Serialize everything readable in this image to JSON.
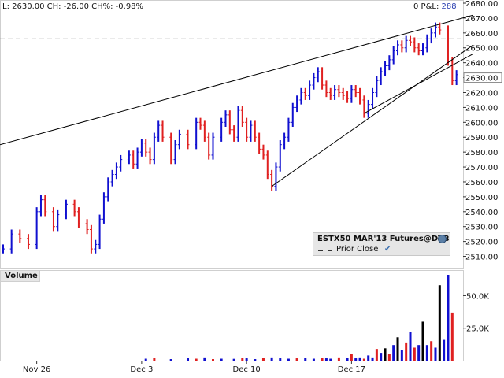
{
  "status_bar": {
    "quote": "L: 2630.00 CH: -26.00 CH%: -0.98%",
    "pnl_label": "0 P&L:",
    "pnl_value": "288"
  },
  "legend": {
    "title": "ESTX50 MAR'13 Futures@DTB",
    "prior_close_label": "Prior Close",
    "gear_icon": "gear-icon",
    "check_icon": "check-icon"
  },
  "volume_panel": {
    "label": "Volume"
  },
  "colors": {
    "up": "#1010d0",
    "down": "#e02020",
    "neutral": "#000000",
    "panel_bg": "#e6e6e6"
  },
  "chart_data": [
    {
      "type": "candlestick",
      "title": "ESTX50 MAR'13 Futures@DTB",
      "x_tick_labels": [
        "Nov 26",
        "Dec 3",
        "Dec 10",
        "Dec 17"
      ],
      "y_tick_labels": [
        2680,
        2670,
        2660,
        2650,
        2640,
        2630,
        2620,
        2610,
        2600,
        2590,
        2580,
        2570,
        2560,
        2550,
        2540,
        2530,
        2520,
        2510
      ],
      "ylim": [
        2505,
        2684
      ],
      "prior_close": 2656,
      "last": 2630,
      "series": [
        {
          "name": "Price",
          "points": [
            [
              0,
              2515
            ],
            [
              2,
              2525
            ],
            [
              4,
              2522
            ],
            [
              6,
              2518
            ],
            [
              8,
              2540
            ],
            [
              9,
              2548
            ],
            [
              10,
              2540
            ],
            [
              12,
              2530
            ],
            [
              13,
              2538
            ],
            [
              15,
              2545
            ],
            [
              17,
              2540
            ],
            [
              18,
              2532
            ],
            [
              20,
              2528
            ],
            [
              21,
              2515
            ],
            [
              22,
              2518
            ],
            [
              23,
              2535
            ],
            [
              24,
              2550
            ],
            [
              25,
              2560
            ],
            [
              26,
              2565
            ],
            [
              27,
              2570
            ],
            [
              28,
              2575
            ],
            [
              30,
              2578
            ],
            [
              31,
              2572
            ],
            [
              32,
              2580
            ],
            [
              33,
              2586
            ],
            [
              34,
              2580
            ],
            [
              35,
              2575
            ],
            [
              36,
              2590
            ],
            [
              37,
              2598
            ],
            [
              38,
              2590
            ],
            [
              40,
              2575
            ],
            [
              41,
              2585
            ],
            [
              42,
              2592
            ],
            [
              44,
              2585
            ],
            [
              46,
              2600
            ],
            [
              47,
              2598
            ],
            [
              48,
              2590
            ],
            [
              49,
              2578
            ],
            [
              50,
              2590
            ],
            [
              52,
              2600
            ],
            [
              53,
              2605
            ],
            [
              54,
              2595
            ],
            [
              55,
              2590
            ],
            [
              56,
              2608
            ],
            [
              57,
              2600
            ],
            [
              58,
              2590
            ],
            [
              59,
              2598
            ],
            [
              60,
              2590
            ],
            [
              61,
              2582
            ],
            [
              62,
              2578
            ],
            [
              63,
              2565
            ],
            [
              64,
              2557
            ],
            [
              65,
              2570
            ],
            [
              66,
              2585
            ],
            [
              67,
              2590
            ],
            [
              68,
              2600
            ],
            [
              69,
              2610
            ],
            [
              70,
              2615
            ],
            [
              71,
              2620
            ],
            [
              72,
              2618
            ],
            [
              73,
              2625
            ],
            [
              74,
              2630
            ],
            [
              75,
              2634
            ],
            [
              76,
              2625
            ],
            [
              77,
              2620
            ],
            [
              78,
              2618
            ],
            [
              79,
              2622
            ],
            [
              80,
              2620
            ],
            [
              81,
              2618
            ],
            [
              82,
              2616
            ],
            [
              83,
              2622
            ],
            [
              84,
              2620
            ],
            [
              85,
              2615
            ],
            [
              86,
              2606
            ],
            [
              87,
              2612
            ],
            [
              88,
              2620
            ],
            [
              89,
              2628
            ],
            [
              90,
              2634
            ],
            [
              91,
              2638
            ],
            [
              92,
              2642
            ],
            [
              93,
              2648
            ],
            [
              94,
              2652
            ],
            [
              95,
              2650
            ],
            [
              96,
              2655
            ],
            [
              97,
              2654
            ],
            [
              98,
              2650
            ],
            [
              99,
              2648
            ],
            [
              100,
              2650
            ],
            [
              101,
              2656
            ],
            [
              102,
              2660
            ],
            [
              103,
              2664
            ],
            [
              104,
              2662
            ],
            [
              106,
              2641
            ],
            [
              107,
              2628
            ],
            [
              108,
              2632
            ]
          ]
        }
      ],
      "trendlines": [
        {
          "from": [
            -2,
            2584
          ],
          "to": [
            112,
            2672
          ]
        },
        {
          "from": [
            64,
            2557
          ],
          "to": [
            112,
            2652
          ]
        },
        {
          "from": [
            86,
            2606
          ],
          "to": [
            112,
            2646
          ]
        }
      ],
      "volume": {
        "ylabel_ticks": [
          "25.0K",
          "50.0K"
        ],
        "ylim": [
          0,
          66000
        ],
        "bars": [
          [
            34,
            1500,
            "up"
          ],
          [
            36,
            2000,
            "down"
          ],
          [
            40,
            1200,
            "up"
          ],
          [
            44,
            1800,
            "up"
          ],
          [
            46,
            1500,
            "down"
          ],
          [
            48,
            2500,
            "up"
          ],
          [
            50,
            1200,
            "down"
          ],
          [
            52,
            1500,
            "up"
          ],
          [
            55,
            1400,
            "up"
          ],
          [
            57,
            2000,
            "down"
          ],
          [
            58,
            1800,
            "up"
          ],
          [
            60,
            1200,
            "up"
          ],
          [
            62,
            2000,
            "down"
          ],
          [
            64,
            2500,
            "up"
          ],
          [
            66,
            1800,
            "up"
          ],
          [
            68,
            1500,
            "up"
          ],
          [
            70,
            1800,
            "down"
          ],
          [
            72,
            2000,
            "up"
          ],
          [
            74,
            1500,
            "up"
          ],
          [
            76,
            2200,
            "down"
          ],
          [
            77,
            1800,
            "up"
          ],
          [
            78,
            1500,
            "up"
          ],
          [
            80,
            2500,
            "down"
          ],
          [
            82,
            2000,
            "up"
          ],
          [
            83,
            5000,
            "down"
          ],
          [
            84,
            1800,
            "up"
          ],
          [
            85,
            2500,
            "up"
          ],
          [
            86,
            1500,
            "down"
          ],
          [
            87,
            4000,
            "up"
          ],
          [
            88,
            2500,
            "up"
          ],
          [
            89,
            9000,
            "down"
          ],
          [
            90,
            6000,
            "up"
          ],
          [
            91,
            9500,
            "neutral"
          ],
          [
            92,
            5000,
            "down"
          ],
          [
            93,
            12000,
            "up"
          ],
          [
            94,
            18000,
            "neutral"
          ],
          [
            95,
            8000,
            "up"
          ],
          [
            96,
            14000,
            "down"
          ],
          [
            97,
            22000,
            "up"
          ],
          [
            98,
            10000,
            "down"
          ],
          [
            99,
            12000,
            "up"
          ],
          [
            100,
            30000,
            "neutral"
          ],
          [
            101,
            12000,
            "up"
          ],
          [
            102,
            15000,
            "down"
          ],
          [
            103,
            10000,
            "up"
          ],
          [
            104,
            58000,
            "neutral"
          ],
          [
            105,
            16000,
            "up"
          ],
          [
            106,
            66000,
            "up"
          ],
          [
            107,
            37000,
            "down"
          ]
        ]
      }
    }
  ]
}
